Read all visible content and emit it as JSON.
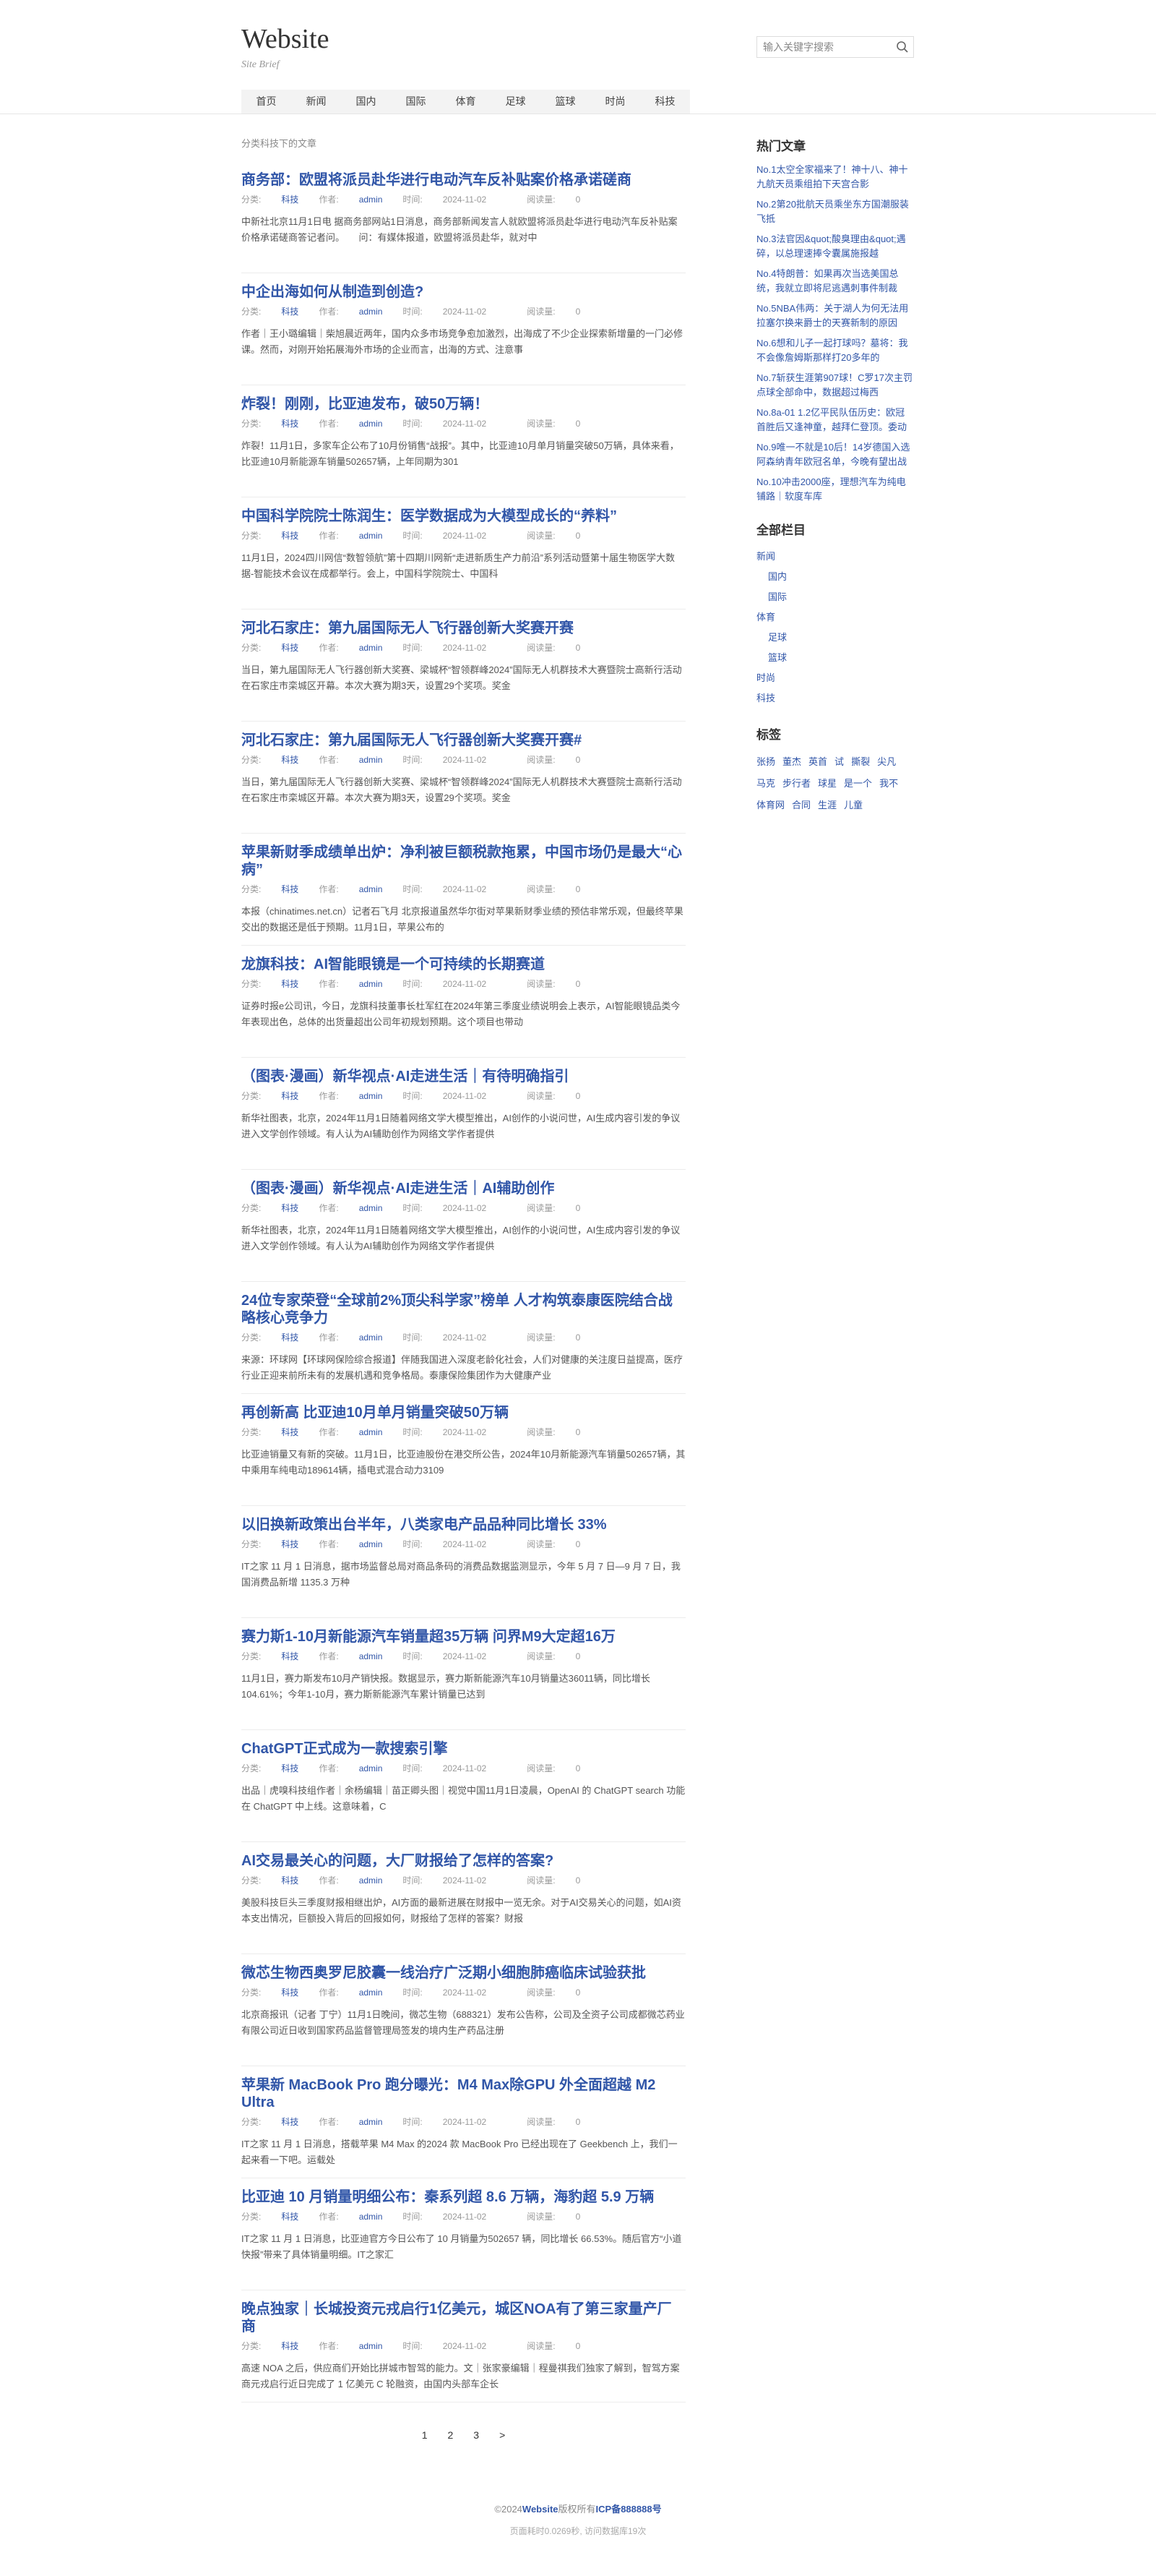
{
  "header": {
    "logo": "Website",
    "brief": "Site Brief",
    "search_placeholder": "输入关键字搜索"
  },
  "nav": [
    "首页",
    "新闻",
    "国内",
    "国际",
    "体育",
    "足球",
    "篮球",
    "时尚",
    "科技"
  ],
  "main": {
    "section_label": "分类科技下的文章",
    "meta_labels": {
      "category": "分类:",
      "author": "作者:",
      "time": "时间:",
      "views": "阅读量:"
    },
    "articles": [
      {
        "title": "商务部：欧盟将派员赴华进行电动汽车反补贴案价格承诺磋商",
        "category": "科技",
        "author": "admin",
        "date": "2024-11-02",
        "views": "0",
        "excerpt": "中新社北京11月1日电 据商务部网站1日消息，商务部新闻发言人就欧盟将派员赴华进行电动汽车反补贴案价格承诺磋商答记者问。　　问：有媒体报道，欧盟将派员赴华，就对中"
      },
      {
        "title": "中企出海如何从制造到创造?",
        "category": "科技",
        "author": "admin",
        "date": "2024-11-02",
        "views": "0",
        "excerpt": "作者｜王小璐编辑｜柴旭晨近两年，国内众多市场竞争愈加激烈，出海成了不少企业探索新增量的一门必修课。然而，对刚开始拓展海外市场的企业而言，出海的方式、注意事"
      },
      {
        "title": "炸裂！刚刚，比亚迪发布，破50万辆！",
        "category": "科技",
        "author": "admin",
        "date": "2024-11-02",
        "views": "0",
        "excerpt": "炸裂！11月1日，多家车企公布了10月份销售“战报”。其中，比亚迪10月单月销量突破50万辆，具体来看，比亚迪10月新能源车销量502657辆，上年同期为301"
      },
      {
        "title": "中国科学院院士陈润生：医学数据成为大模型成长的“养料”",
        "category": "科技",
        "author": "admin",
        "date": "2024-11-02",
        "views": "0",
        "excerpt": "11月1日，2024四川网信“数智领航”第十四期川网新“走进新质生产力前沿”系列活动暨第十届生物医学大数据-智能技术会议在成都举行。会上，中国科学院院士、中国科"
      },
      {
        "title": "河北石家庄：第九届国际无人飞行器创新大奖赛开赛",
        "category": "科技",
        "author": "admin",
        "date": "2024-11-02",
        "views": "0",
        "excerpt": "当日，第九届国际无人飞行器创新大奖赛、梁城杯“智领群峰2024”国际无人机群技术大赛暨院士高新行活动在石家庄市栾城区开幕。本次大赛为期3天，设置29个奖项。奖金"
      },
      {
        "title": "河北石家庄：第九届国际无人飞行器创新大奖赛开赛#",
        "category": "科技",
        "author": "admin",
        "date": "2024-11-02",
        "views": "0",
        "excerpt": "当日，第九届国际无人飞行器创新大奖赛、梁城杯“智领群峰2024”国际无人机群技术大赛暨院士高新行活动在石家庄市栾城区开幕。本次大赛为期3天，设置29个奖项。奖金"
      },
      {
        "title": "苹果新财季成绩单出炉：净利被巨额税款拖累，中国市场仍是最大“心病”",
        "category": "科技",
        "author": "admin",
        "date": "2024-11-02",
        "views": "0",
        "excerpt": "本报（chinatimes.net.cn）记者石飞月 北京报道虽然华尔街对苹果新财季业绩的预估非常乐观，但最终苹果交出的数据还是低于预期。11月1日，苹果公布的"
      },
      {
        "title": "龙旗科技：AI智能眼镜是一个可持续的长期赛道",
        "category": "科技",
        "author": "admin",
        "date": "2024-11-02",
        "views": "0",
        "excerpt": "证券时报e公司讯，今日，龙旗科技董事长杜军红在2024年第三季度业绩说明会上表示，AI智能眼镜品类今年表现出色，总体的出货量超出公司年初规划预期。这个项目也带动"
      },
      {
        "title": "（图表·漫画）新华视点·AI走进生活｜有待明确指引",
        "category": "科技",
        "author": "admin",
        "date": "2024-11-02",
        "views": "0",
        "excerpt": "新华社图表，北京，2024年11月1日随着网络文学大模型推出，AI创作的小说问世，AI生成内容引发的争议进入文学创作领域。有人认为AI辅助创作为网络文学作者提供"
      },
      {
        "title": "（图表·漫画）新华视点·AI走进生活｜AI辅助创作",
        "category": "科技",
        "author": "admin",
        "date": "2024-11-02",
        "views": "0",
        "excerpt": "新华社图表，北京，2024年11月1日随着网络文学大模型推出，AI创作的小说问世，AI生成内容引发的争议进入文学创作领域。有人认为AI辅助创作为网络文学作者提供"
      },
      {
        "title": "24位专家荣登“全球前2%顶尖科学家”榜单 人才构筑泰康医院结合战略核心竞争力",
        "category": "科技",
        "author": "admin",
        "date": "2024-11-02",
        "views": "0",
        "excerpt": "来源：环球网【环球网保险综合报道】伴随我国进入深度老龄化社会，人们对健康的关注度日益提高，医疗行业正迎来前所未有的发展机遇和竞争格局。泰康保险集团作为大健康产业"
      },
      {
        "title": "再创新高 比亚迪10月单月销量突破50万辆",
        "category": "科技",
        "author": "admin",
        "date": "2024-11-02",
        "views": "0",
        "excerpt": "比亚迪销量又有新的突破。11月1日，比亚迪股份在港交所公告，2024年10月新能源汽车销量502657辆，其中乘用车纯电动189614辆，插电式混合动力3109"
      },
      {
        "title": "以旧换新政策出台半年，八类家电产品品种同比增长 33%",
        "category": "科技",
        "author": "admin",
        "date": "2024-11-02",
        "views": "0",
        "excerpt": "IT之家 11 月 1 日消息，据市场监督总局对商品条码的消费品数据监测显示，今年 5 月 7 日—9 月 7 日，我国消费品新增 1135.3 万种"
      },
      {
        "title": "赛力斯1-10月新能源汽车销量超35万辆 问界M9大定超16万",
        "category": "科技",
        "author": "admin",
        "date": "2024-11-02",
        "views": "0",
        "excerpt": "11月1日，赛力斯发布10月产销快报。数据显示，赛力斯新能源汽车10月销量达36011辆，同比增长104.61%；今年1-10月，赛力斯新能源汽车累计销量已达到"
      },
      {
        "title": "ChatGPT正式成为一款搜索引擎",
        "category": "科技",
        "author": "admin",
        "date": "2024-11-02",
        "views": "0",
        "excerpt": "出品｜虎嗅科技组作者｜余杨编辑｜苗正卿头图｜视觉中国11月1日凌晨，OpenAI 的 ChatGPT search 功能在 ChatGPT 中上线。这意味着，C"
      },
      {
        "title": "AI交易最关心的问题，大厂财报给了怎样的答案?",
        "category": "科技",
        "author": "admin",
        "date": "2024-11-02",
        "views": "0",
        "excerpt": "美股科技巨头三季度财报相继出炉，AI方面的最新进展在财报中一览无余。对于AI交易关心的问题，如AI资本支出情况，巨额投入背后的回报如何，财报给了怎样的答案？财报"
      },
      {
        "title": "微芯生物西奥罗尼胶囊一线治疗广泛期小细胞肺癌临床试验获批",
        "category": "科技",
        "author": "admin",
        "date": "2024-11-02",
        "views": "0",
        "excerpt": "北京商报讯（记者 丁宁）11月1日晚间，微芯生物（688321）发布公告称，公司及全资子公司成都微芯药业有限公司近日收到国家药品监督管理局签发的境内生产药品注册"
      },
      {
        "title": "苹果新 MacBook Pro 跑分曝光：M4 Max除GPU 外全面超越 M2 Ultra",
        "category": "科技",
        "author": "admin",
        "date": "2024-11-02",
        "views": "0",
        "excerpt": "IT之家 11 月 1 日消息，搭载苹果 M4 Max 的2024 款 MacBook Pro 已经出现在了 Geekbench 上，我们一起来看一下吧。运载处"
      },
      {
        "title": "比亚迪 10 月销量明细公布：秦系列超 8.6 万辆，海豹超 5.9 万辆",
        "category": "科技",
        "author": "admin",
        "date": "2024-11-02",
        "views": "0",
        "excerpt": "IT之家 11 月 1 日消息，比亚迪官方今日公布了 10 月销量为502657 辆，同比增长 66.53%。随后官方“小道快报”带来了具体销量明细。IT之家汇"
      },
      {
        "title": "晚点独家｜长城投资元戎启行1亿美元，城区NOA有了第三家量产厂商",
        "category": "科技",
        "author": "admin",
        "date": "2024-11-02",
        "views": "0",
        "excerpt": "高速 NOA 之后，供应商们开始比拼城市智驾的能力。文｜张家豪编辑｜程曼祺我们独家了解到，智驾方案商元戎启行近日完成了 1 亿美元 C 轮融资，由国内头部车企长"
      }
    ]
  },
  "pagination": [
    "1",
    "2",
    "3",
    ">"
  ],
  "sidebar": {
    "hot_title": "热门文章",
    "hot_articles": [
      "No.1太空全家福来了！神十八、神十九航天员乘组拍下天宫合影",
      "No.2第20批航天员乘坐东方国潮服装飞抵",
      "No.3法官因&quot;酸臭理由&quot;遇碎，以总理速捧令囊属施报越",
      "No.4特朗普：如果再次当选美国总统，我就立即将尼逃遇刺事件制裁",
      "No.5NBA伟两：关于湖人为何无法用拉塞尔换来爵士的天赛新制的原因",
      "No.6想和儿子一起打球吗？墓将：我不会像詹姆斯那样打20多年的",
      "No.7斩获生涯第907球！C罗17次主罚点球全部命中，数据超过梅西",
      "No.8a-01 1.2亿平民队伍历史：欧冠首胜后又逢神童，越拜仁登顶。委动",
      "No.9唯一不就是10后！14岁德国入选阿森纳青年欧冠名单，今晚有望出战",
      "No.10冲击2000座，理想汽车为纯电铺路｜软度车库"
    ],
    "cat_title": "全部栏目",
    "categories": [
      {
        "label": "新闻",
        "sub": false
      },
      {
        "label": "国内",
        "sub": true
      },
      {
        "label": "国际",
        "sub": true
      },
      {
        "label": "体育",
        "sub": false
      },
      {
        "label": "足球",
        "sub": true
      },
      {
        "label": "篮球",
        "sub": true
      },
      {
        "label": "时尚",
        "sub": false
      },
      {
        "label": "科技",
        "sub": false
      }
    ],
    "tags_title": "标签",
    "tags": [
      "张扬",
      "董杰",
      "英首",
      "试",
      "撕裂",
      "尖凡",
      "马克",
      "步行者",
      "球星",
      "是一个",
      "我不",
      "体育网",
      "合同",
      "生涯",
      "儿童"
    ]
  },
  "footer": {
    "prefix": "©2024",
    "site": "Website",
    "mid": "版权所有",
    "icp": "ICP备888888号",
    "stats": "页面耗时0.0269秒, 访问数据库19次"
  }
}
